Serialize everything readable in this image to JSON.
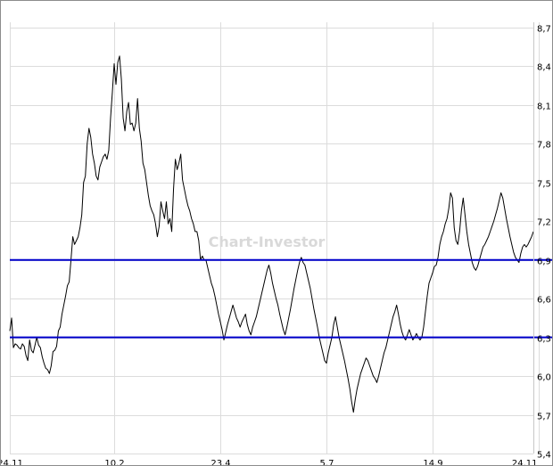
{
  "watermark": "Chart-Investor",
  "chart_data": {
    "type": "line",
    "title": "",
    "xlabel": "",
    "ylabel": "",
    "ylim": [
      5.4,
      8.7
    ],
    "y_ticks": [
      "5,4",
      "5,7",
      "6,0",
      "6,3",
      "6,6",
      "6,9",
      "7,2",
      "7,5",
      "7,8",
      "8,1",
      "8,4",
      "8,7"
    ],
    "y_tick_values": [
      5.4,
      5.7,
      6.0,
      6.3,
      6.6,
      6.9,
      7.2,
      7.5,
      7.8,
      8.1,
      8.4,
      8.7
    ],
    "x_ticks": [
      "24.11",
      "10.2",
      "23.4",
      "5.7",
      "14.9",
      "24.11"
    ],
    "x_tick_index": [
      0,
      58,
      117,
      176,
      235,
      294
    ],
    "grid": true,
    "horizontal_lines": [
      {
        "value": 6.9,
        "color": "#0000cc"
      },
      {
        "value": 6.3,
        "color": "#0000cc"
      }
    ],
    "series": [
      {
        "color": "#000000",
        "values": [
          6.35,
          6.45,
          6.22,
          6.25,
          6.24,
          6.22,
          6.21,
          6.25,
          6.23,
          6.16,
          6.12,
          6.28,
          6.2,
          6.18,
          6.24,
          6.3,
          6.24,
          6.22,
          6.15,
          6.1,
          6.06,
          6.05,
          6.02,
          6.08,
          6.19,
          6.2,
          6.23,
          6.35,
          6.38,
          6.48,
          6.55,
          6.62,
          6.7,
          6.73,
          6.9,
          7.08,
          7.02,
          7.05,
          7.08,
          7.15,
          7.25,
          7.5,
          7.55,
          7.8,
          7.92,
          7.85,
          7.72,
          7.65,
          7.55,
          7.52,
          7.62,
          7.66,
          7.7,
          7.72,
          7.68,
          7.75,
          8.0,
          8.2,
          8.42,
          8.26,
          8.43,
          8.48,
          8.3,
          8.0,
          7.9,
          8.05,
          8.12,
          7.95,
          7.96,
          7.9,
          7.96,
          8.15,
          7.92,
          7.82,
          7.65,
          7.6,
          7.5,
          7.4,
          7.32,
          7.28,
          7.25,
          7.18,
          7.08,
          7.16,
          7.35,
          7.28,
          7.22,
          7.35,
          7.18,
          7.22,
          7.12,
          7.45,
          7.68,
          7.6,
          7.65,
          7.72,
          7.52,
          7.45,
          7.38,
          7.32,
          7.28,
          7.22,
          7.18,
          7.12,
          7.12,
          7.05,
          6.9,
          6.93,
          6.9,
          6.9,
          6.84,
          6.78,
          6.72,
          6.68,
          6.62,
          6.55,
          6.48,
          6.42,
          6.36,
          6.28,
          6.34,
          6.4,
          6.45,
          6.5,
          6.55,
          6.5,
          6.45,
          6.42,
          6.38,
          6.42,
          6.45,
          6.48,
          6.4,
          6.35,
          6.32,
          6.38,
          6.42,
          6.46,
          6.52,
          6.58,
          6.64,
          6.7,
          6.76,
          6.82,
          6.86,
          6.8,
          6.72,
          6.66,
          6.6,
          6.55,
          6.48,
          6.42,
          6.36,
          6.32,
          6.38,
          6.45,
          6.52,
          6.6,
          6.68,
          6.75,
          6.82,
          6.88,
          6.92,
          6.88,
          6.86,
          6.8,
          6.74,
          6.68,
          6.6,
          6.52,
          6.45,
          6.38,
          6.3,
          6.24,
          6.18,
          6.12,
          6.1,
          6.18,
          6.24,
          6.3,
          6.4,
          6.46,
          6.38,
          6.3,
          6.24,
          6.18,
          6.12,
          6.05,
          5.98,
          5.9,
          5.8,
          5.72,
          5.82,
          5.9,
          5.96,
          6.02,
          6.06,
          6.1,
          6.14,
          6.12,
          6.08,
          6.04,
          6.0,
          5.98,
          5.95,
          6.0,
          6.06,
          6.12,
          6.18,
          6.22,
          6.28,
          6.34,
          6.4,
          6.46,
          6.5,
          6.55,
          6.48,
          6.4,
          6.34,
          6.3,
          6.28,
          6.32,
          6.36,
          6.32,
          6.28,
          6.3,
          6.33,
          6.3,
          6.28,
          6.3,
          6.38,
          6.5,
          6.62,
          6.72,
          6.76,
          6.8,
          6.85,
          6.86,
          6.92,
          7.02,
          7.08,
          7.12,
          7.18,
          7.22,
          7.3,
          7.42,
          7.38,
          7.15,
          7.05,
          7.02,
          7.12,
          7.28,
          7.38,
          7.25,
          7.12,
          7.02,
          6.95,
          6.88,
          6.84,
          6.82,
          6.85,
          6.9,
          6.95,
          7.0,
          7.02,
          7.05,
          7.08,
          7.12,
          7.16,
          7.2,
          7.25,
          7.3,
          7.36,
          7.42,
          7.38,
          7.3,
          7.22,
          7.15,
          7.08,
          7.02,
          6.96,
          6.92,
          6.9,
          6.88,
          6.95,
          7.0,
          7.02,
          7.0,
          7.02,
          7.05,
          7.08,
          7.12
        ]
      }
    ]
  }
}
